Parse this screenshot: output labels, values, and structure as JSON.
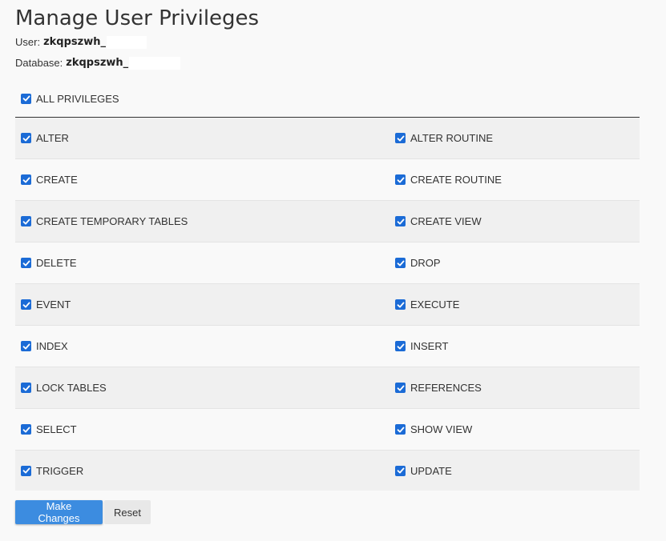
{
  "title": "Manage User Privileges",
  "user": {
    "label": "User:",
    "value": "zkqpszwh_"
  },
  "database": {
    "label": "Database:",
    "value": "zkqpszwh_"
  },
  "all_privileges": {
    "label": "ALL PRIVILEGES",
    "checked": true
  },
  "privileges": [
    {
      "left": "ALTER",
      "right": "ALTER ROUTINE"
    },
    {
      "left": "CREATE",
      "right": "CREATE ROUTINE"
    },
    {
      "left": "CREATE TEMPORARY TABLES",
      "right": "CREATE VIEW"
    },
    {
      "left": "DELETE",
      "right": "DROP"
    },
    {
      "left": "EVENT",
      "right": "EXECUTE"
    },
    {
      "left": "INDEX",
      "right": "INSERT"
    },
    {
      "left": "LOCK TABLES",
      "right": "REFERENCES"
    },
    {
      "left": "SELECT",
      "right": "SHOW VIEW"
    },
    {
      "left": "TRIGGER",
      "right": "UPDATE"
    }
  ],
  "buttons": {
    "make_changes": "Make Changes",
    "reset": "Reset"
  },
  "colors": {
    "checkbox": "#1b6bd6",
    "primary_button": "#3c8ce0"
  },
  "icons": {
    "checkbox": "checkmark-icon"
  }
}
